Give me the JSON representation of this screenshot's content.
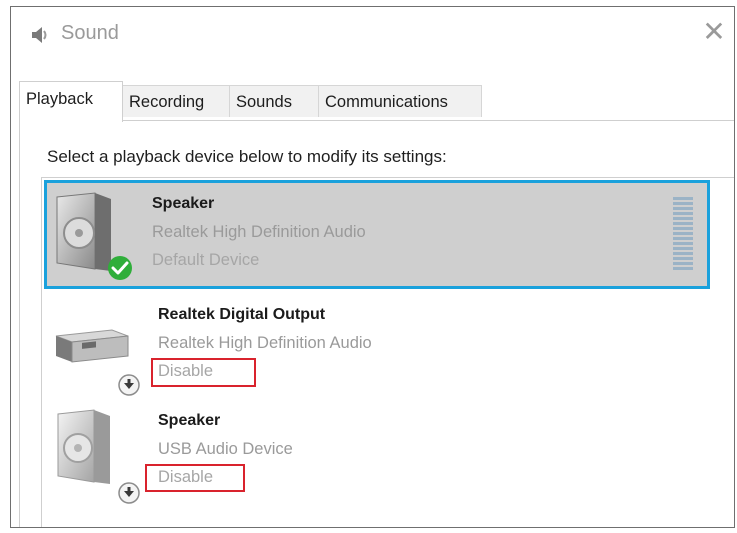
{
  "window": {
    "title": "Sound",
    "close_glyph": "✕",
    "icon": "speaker-app-icon"
  },
  "tabs": [
    {
      "label": "Playback",
      "active": true
    },
    {
      "label": "Recording",
      "active": false
    },
    {
      "label": "Sounds",
      "active": false
    },
    {
      "label": "Communications",
      "active": false
    }
  ],
  "instruction": "Select a playback device below to modify its settings:",
  "devices": [
    {
      "name": "Speaker",
      "description": "Realtek High Definition Audio",
      "status": "Default Device",
      "icon": "speaker-icon",
      "badge": "check-badge-icon",
      "selected": true
    },
    {
      "name": "Realtek Digital Output",
      "description": "Realtek High Definition Audio",
      "status": "Disable",
      "icon": "digital-output-icon",
      "badge": "down-arrow-badge-icon",
      "selected": false
    },
    {
      "name": "Speaker",
      "description": "USB Audio Device",
      "status": "Disable",
      "icon": "speaker-icon",
      "badge": "down-arrow-badge-icon",
      "selected": false
    }
  ],
  "colors": {
    "selection_border": "#1aa1dc",
    "selection_fill": "#cfcfcf",
    "highlight_box": "#d9232d",
    "check_green": "#2fae3a"
  }
}
